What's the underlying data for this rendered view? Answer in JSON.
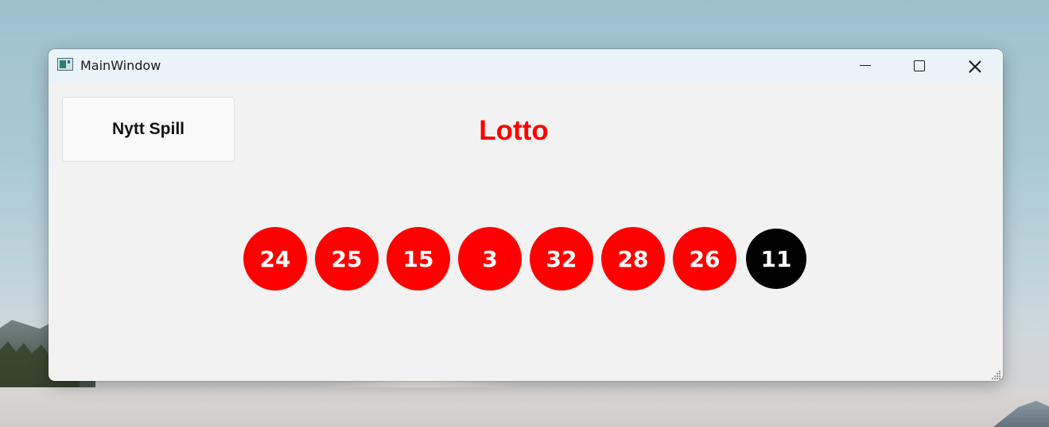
{
  "window": {
    "title": "MainWindow"
  },
  "toolbar": {
    "new_game_label": "Nytt Spill"
  },
  "main": {
    "title": "Lotto",
    "title_color": "#ff0000"
  },
  "balls": [
    {
      "number": "24",
      "color": "#ff0000",
      "kind": "main"
    },
    {
      "number": "25",
      "color": "#ff0000",
      "kind": "main"
    },
    {
      "number": "15",
      "color": "#ff0000",
      "kind": "main"
    },
    {
      "number": "3",
      "color": "#ff0000",
      "kind": "main"
    },
    {
      "number": "32",
      "color": "#ff0000",
      "kind": "main"
    },
    {
      "number": "28",
      "color": "#ff0000",
      "kind": "main"
    },
    {
      "number": "26",
      "color": "#ff0000",
      "kind": "main"
    },
    {
      "number": "11",
      "color": "#000000",
      "kind": "extra"
    }
  ],
  "icons": {
    "app": "app-window-icon",
    "minimize": "minimize-icon",
    "maximize": "maximize-icon",
    "close": "close-icon",
    "resize": "resize-grip-icon"
  }
}
